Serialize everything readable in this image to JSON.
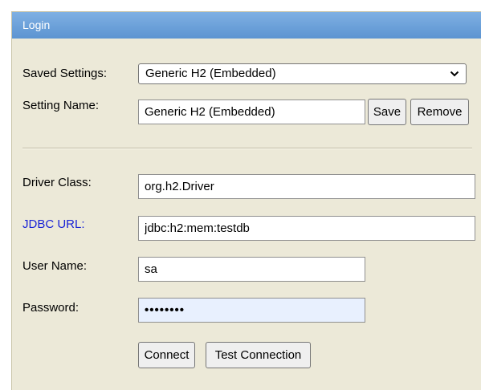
{
  "window": {
    "title": "Login"
  },
  "saved_settings": {
    "label": "Saved Settings:",
    "selected": "Generic H2 (Embedded)"
  },
  "setting_name": {
    "label": "Setting Name:",
    "value": "Generic H2 (Embedded)",
    "save_label": "Save",
    "remove_label": "Remove"
  },
  "driver_class": {
    "label": "Driver Class:",
    "value": "org.h2.Driver"
  },
  "jdbc_url": {
    "label": "JDBC URL:",
    "value": "jdbc:h2:mem:testdb"
  },
  "user_name": {
    "label": "User Name:",
    "value": "sa"
  },
  "password": {
    "label": "Password:",
    "value": "••••••••"
  },
  "actions": {
    "connect_label": "Connect",
    "test_label": "Test Connection"
  },
  "colors": {
    "title_bar": "#6aa1dd",
    "panel_bg": "#ece9d8",
    "link_label": "#1a23d6",
    "autofill_bg": "#e8f0fe"
  }
}
